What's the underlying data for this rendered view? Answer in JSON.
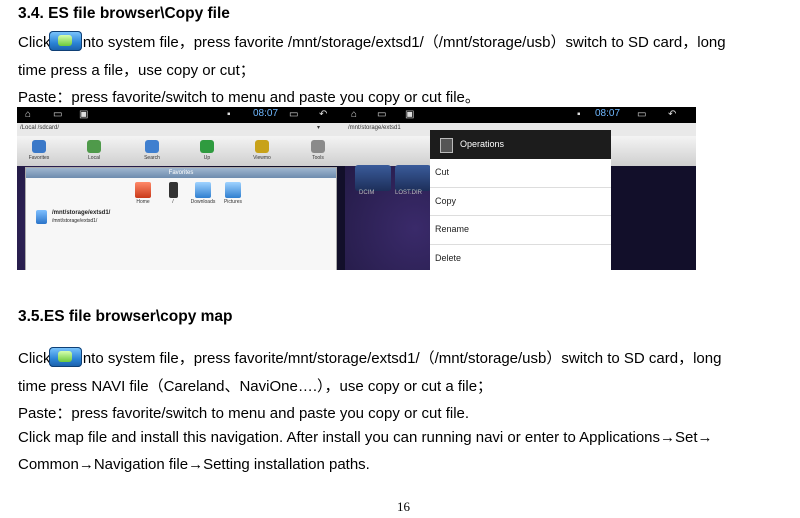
{
  "section1": {
    "heading": "3.4. ES file browser\\Copy file",
    "line1_a": "Click",
    "line1_b": "into system file，press favorite /mnt/storage/extsd1/（/mnt/storage/usb）switch to SD card，long",
    "line2": "time press a file，use copy or cut；",
    "line3": "Paste：press favorite/switch to menu and paste you copy or cut file。"
  },
  "screenshot1": {
    "time": "08:07",
    "address": "/Local  /sdcard/",
    "toolbar": [
      "Favorites",
      "Local",
      "Search",
      "Up",
      "Viewmo",
      "Tools"
    ],
    "favorites_title": "Favorites",
    "favorites": [
      "Home",
      "/",
      "Downloads",
      "Pictures"
    ],
    "path_main": "/mnt/storage/extsd1/",
    "path_sub": "/mnt/storage/extsd1/"
  },
  "screenshot2": {
    "time": "08:07",
    "address": "/mnt/storage/extsd1",
    "menu_title": "Operations",
    "menu_items": [
      "Cut",
      "Copy",
      "Rename",
      "Delete"
    ],
    "bg_labels": [
      "DCIM",
      "LOST.DIR"
    ]
  },
  "section2": {
    "heading": "3.5.ES file browser\\copy map",
    "line1_a": "Click",
    "line1_b": "into system file，press favorite/mnt/storage/extsd1/（/mnt/storage/usb）switch to SD card，long",
    "line2": "time press NAVI file（Careland、NaviOne….），use copy or cut a file；",
    "line3": "Paste：press favorite/switch to menu and paste you copy or cut file.",
    "line4": "Click map file and install this navigation. After install you can running navi or enter to Applications→Set→",
    "line5": "Common→Navigation file→Setting installation paths."
  },
  "page_number": "16",
  "colors": {
    "status_time": "#6fb8ff",
    "menu_header": "#1c1c1c",
    "folder_blue": "#2a74c9"
  }
}
